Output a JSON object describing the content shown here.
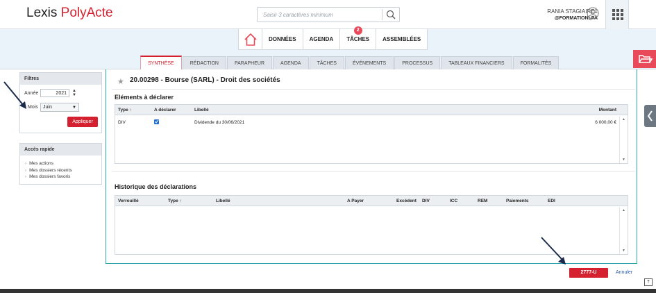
{
  "app": {
    "logo_prefix": "Lexis ",
    "logo_brand": "PolyActe"
  },
  "search": {
    "placeholder": "Saisir 3 caractères minimum",
    "icon": "search-icon"
  },
  "user": {
    "name": "RANIA STAGIAIRE1",
    "org": "@FORMATIONLPA",
    "icon": "user-avatar-icon"
  },
  "topnav": {
    "items": [
      {
        "label": "DONNÉES"
      },
      {
        "label": "AGENDA"
      },
      {
        "label": "TÂCHES",
        "badge": "2"
      },
      {
        "label": "ASSEMBLÉES"
      }
    ]
  },
  "tabs": [
    "SYNTHÈSE",
    "RÉDACTION",
    "PARAPHEUR",
    "AGENDA",
    "TÂCHES",
    "ÉVÉNEMENTS",
    "PROCESSUS",
    "TABLEAUX FINANCIERS",
    "FORMALITÉS"
  ],
  "sidebar": {
    "filtres_title": "Filtres",
    "annee_label": "Année",
    "annee_value": "2021",
    "mois_label": "Mois",
    "mois_value": "Juin",
    "apply_label": "Appliquer",
    "acces_title": "Accès rapide",
    "links": [
      "Mes actions",
      "Mes dossiers récents",
      "Mes dossiers favoris"
    ]
  },
  "dossier": {
    "title": "20.00298 - Bourse (SARL) - Droit des sociétés"
  },
  "elements": {
    "title": "Eléments à déclarer",
    "columns": {
      "type": "Type",
      "a_declarer": "A déclarer",
      "libelle": "Libellé",
      "montant": "Montant"
    },
    "rows": [
      {
        "type": "DIV",
        "libelle": "Dividende du 30/06/2021",
        "montant": "6 000,00 €",
        "checked": true
      }
    ]
  },
  "historique": {
    "title": "Historique des déclarations",
    "columns": [
      "Verrouillé",
      "Type",
      "Libellé",
      "A Payer",
      "Excédent",
      "DIV",
      "ICC",
      "REM",
      "Paiements",
      "EDI"
    ]
  },
  "actions": {
    "primary": "2777-U",
    "cancel": "Annuler"
  },
  "colors": {
    "brand": "#d4202f",
    "accent": "#2aa3ad",
    "band": "#eaf2fa"
  }
}
